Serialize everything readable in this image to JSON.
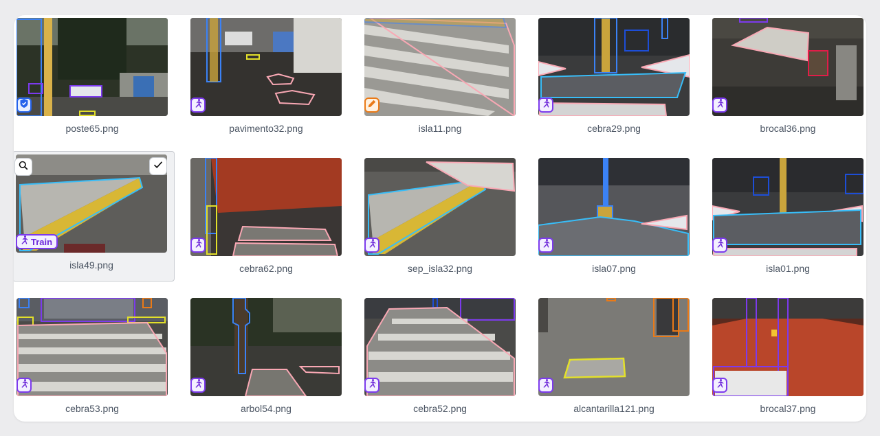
{
  "gallery": {
    "items": [
      {
        "filename": "poste65.png",
        "badge": "shield-icon"
      },
      {
        "filename": "pavimento32.png",
        "badge": "runner-icon"
      },
      {
        "filename": "isla11.png",
        "badge": "pencil-icon"
      },
      {
        "filename": "cebra29.png",
        "badge": "runner-icon"
      },
      {
        "filename": "brocal36.png",
        "badge": "runner-icon"
      },
      {
        "filename": "isla49.png",
        "badge": "runner-icon",
        "badge_label": "Train",
        "selected": true
      },
      {
        "filename": "cebra62.png",
        "badge": "runner-icon"
      },
      {
        "filename": "sep_isla32.png",
        "badge": "runner-icon"
      },
      {
        "filename": "isla07.png",
        "badge": "runner-icon"
      },
      {
        "filename": "isla01.png",
        "badge": "runner-icon"
      },
      {
        "filename": "cebra53.png",
        "badge": "runner-icon"
      },
      {
        "filename": "arbol54.png",
        "badge": "runner-icon"
      },
      {
        "filename": "cebra52.png",
        "badge": "runner-icon"
      },
      {
        "filename": "alcantarilla121.png",
        "badge": "runner-icon"
      },
      {
        "filename": "brocal37.png",
        "badge": "runner-icon"
      }
    ]
  },
  "colors": {
    "split_train": "#7c3aed",
    "split_valid": "#2563eb",
    "split_test": "#ea7a17"
  }
}
